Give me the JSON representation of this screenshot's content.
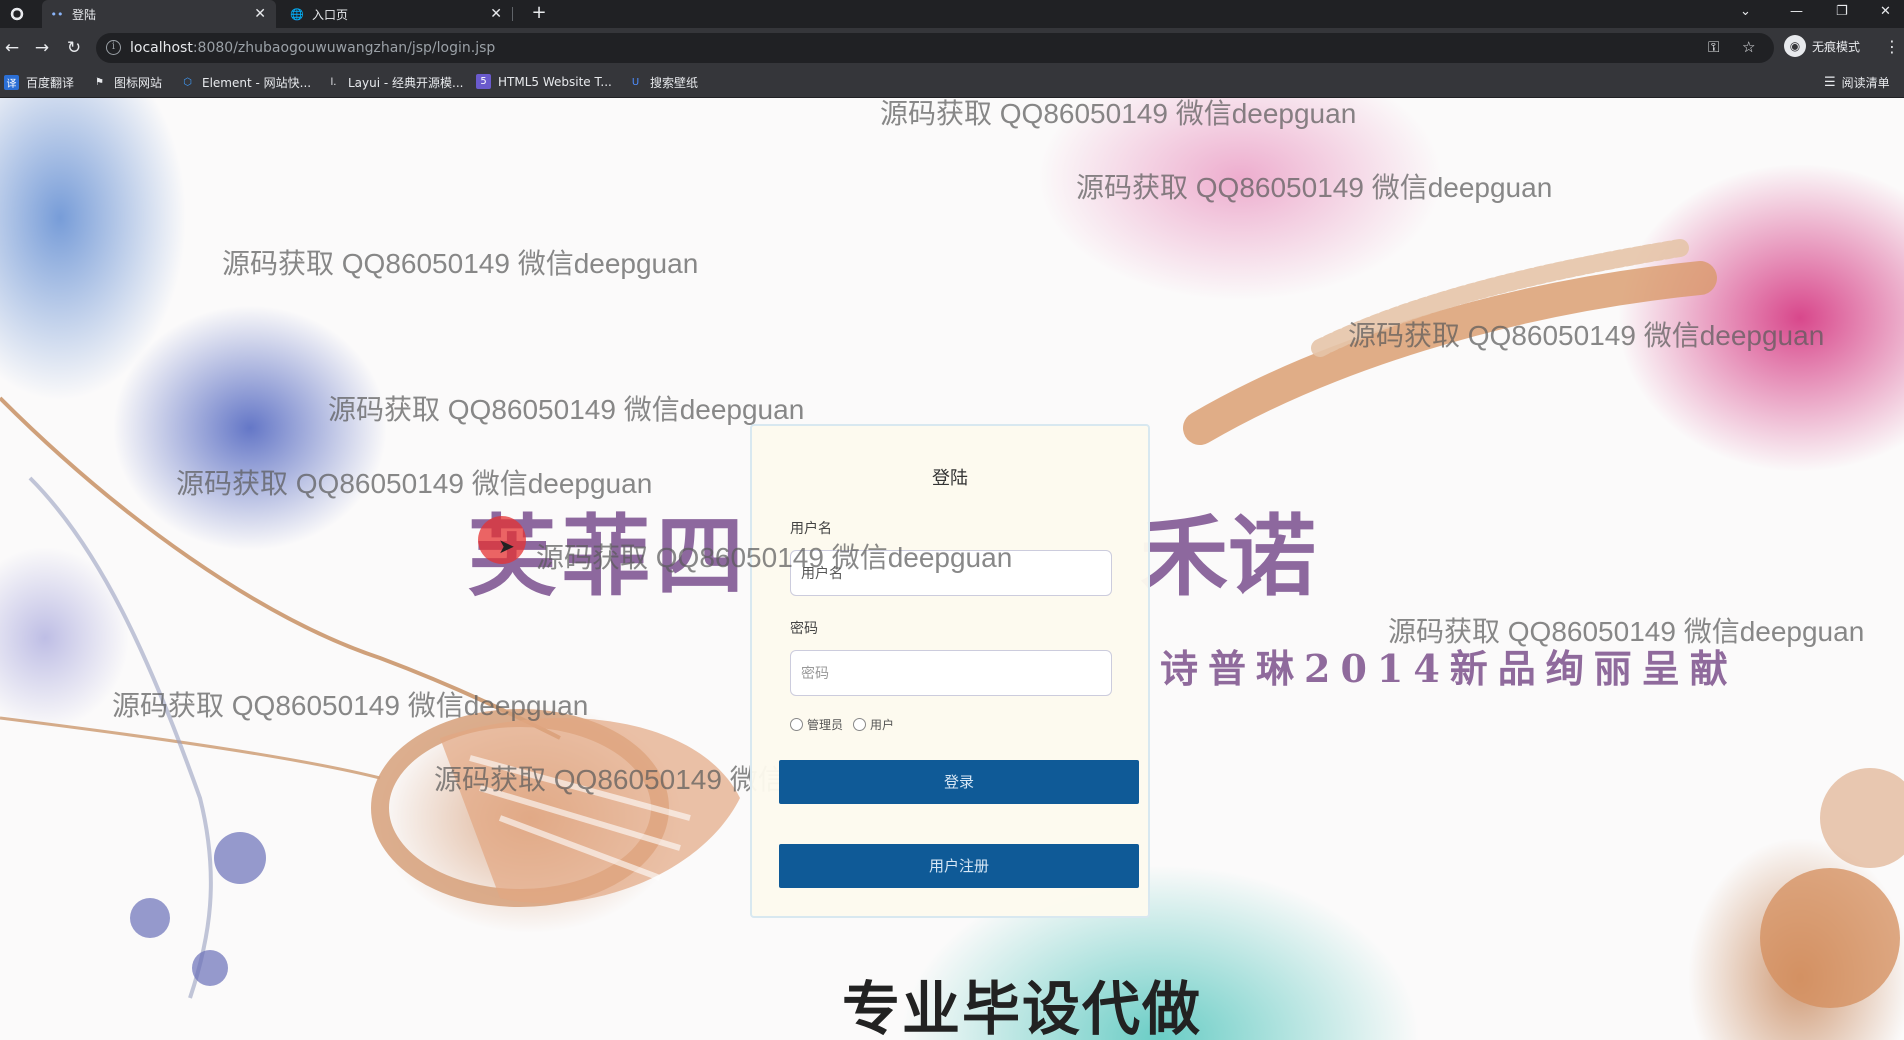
{
  "browser": {
    "tabs": [
      {
        "label": "登陆",
        "active": true
      },
      {
        "label": "入口页",
        "active": false
      }
    ],
    "new_tab": "+",
    "url_host": "localhost",
    "url_rest": ":8080/zhubaogouwuwangzhan/jsp/login.jsp",
    "incognito_label": "无痕模式",
    "bookmarks": [
      {
        "label": "百度翻译",
        "icon": "translate-icon"
      },
      {
        "label": "图标网站",
        "icon": "flag-icon"
      },
      {
        "label": "Element - 网站快...",
        "icon": "element-icon"
      },
      {
        "label": "Layui - 经典开源模...",
        "icon": "layui-icon"
      },
      {
        "label": "HTML5 Website T...",
        "icon": "html5-icon"
      },
      {
        "label": "搜索壁纸",
        "icon": "wallpaper-icon"
      }
    ],
    "reading_list": "阅读清单"
  },
  "background": {
    "brand_left": "芙菲四",
    "brand_right": "禾诺",
    "slogan": "诗普琳2014新品绚丽呈献",
    "bottom_banner": "专业毕设代做",
    "watermark_text": "源码获取 QQ86050149 微信deepguan",
    "accent_colors": {
      "orchid_blue": "#4a60be",
      "orchid_pink": "#d22878",
      "teal": "#3abeb4",
      "gold": "#c4824a"
    }
  },
  "login": {
    "title": "登陆",
    "username_label": "用户名",
    "username_value": "用户名",
    "password_label": "密码",
    "password_placeholder": "密码",
    "role_admin": "管理员",
    "role_user": "用户",
    "login_button": "登录",
    "register_button": "用户注册",
    "button_color": "#0f5a97"
  }
}
